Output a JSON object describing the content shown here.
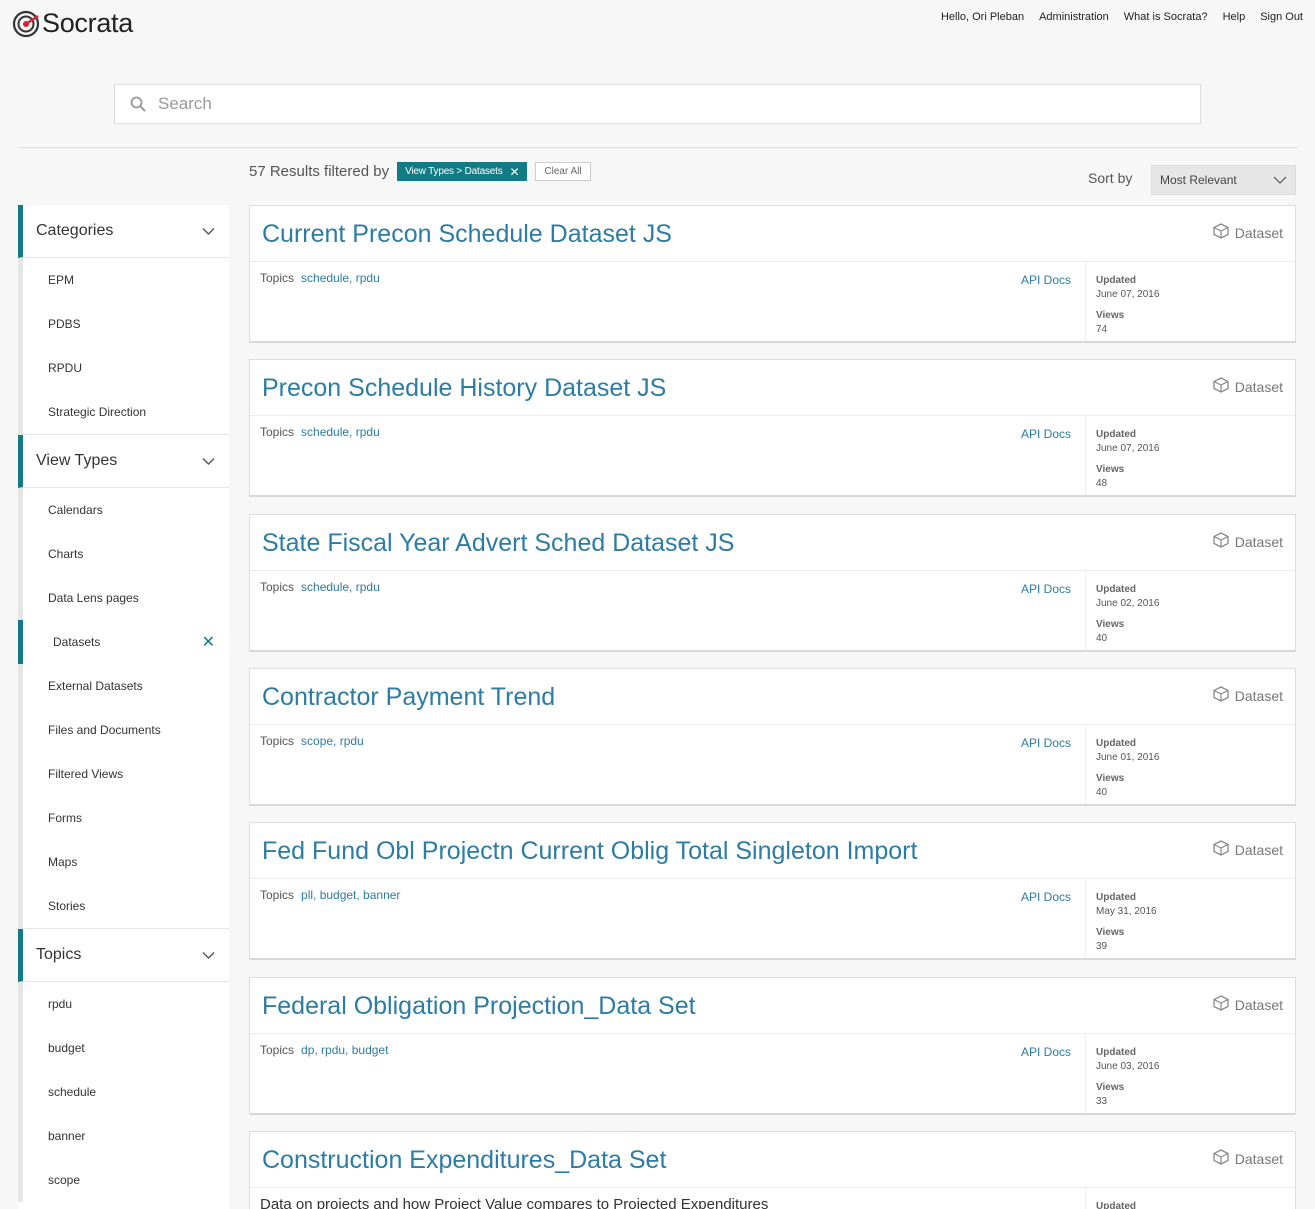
{
  "brand": {
    "name": "Socrata"
  },
  "nav": {
    "hello": "Hello, Ori Pleban",
    "administration": "Administration",
    "what_is": "What is Socrata?",
    "help": "Help",
    "sign_out": "Sign Out"
  },
  "search": {
    "placeholder": "Search"
  },
  "results": {
    "count_text": "57 Results filtered by",
    "filter_pill": "View Types > Datasets",
    "clear_all": "Clear All",
    "sort_label": "Sort by",
    "sort_value": "Most Relevant"
  },
  "sidebar": {
    "categories": {
      "title": "Categories",
      "items": [
        "EPM",
        "PDBS",
        "RPDU",
        "Strategic Direction"
      ]
    },
    "view_types": {
      "title": "View Types",
      "items": [
        "Calendars",
        "Charts",
        "Data Lens pages",
        "Datasets",
        "External Datasets",
        "Files and Documents",
        "Filtered Views",
        "Forms",
        "Maps",
        "Stories"
      ]
    },
    "topics": {
      "title": "Topics",
      "items": [
        "rpdu",
        "budget",
        "schedule",
        "banner",
        "scope"
      ]
    }
  },
  "labels": {
    "topics": "Topics",
    "api_docs": "API Docs",
    "updated": "Updated",
    "views": "Views",
    "dataset": "Dataset"
  },
  "cards": [
    {
      "title": "Current Precon Schedule Dataset JS",
      "topics": "schedule, rpdu",
      "updated": "June 07, 2016",
      "views": "74"
    },
    {
      "title": "Precon Schedule History Dataset JS",
      "topics": "schedule, rpdu",
      "updated": "June 07, 2016",
      "views": "48"
    },
    {
      "title": "State Fiscal Year Advert Sched Dataset JS",
      "topics": "schedule, rpdu",
      "updated": "June 02, 2016",
      "views": "40"
    },
    {
      "title": "Contractor Payment Trend",
      "topics": "scope, rpdu",
      "updated": "June 01, 2016",
      "views": "40"
    },
    {
      "title": "Fed Fund Obl Projectn Current Oblig Total Singleton Import",
      "topics": "pll, budget, banner",
      "updated": "May 31, 2016",
      "views": "39"
    },
    {
      "title": "Federal Obligation Projection_Data Set",
      "topics": "dp, rpdu, budget",
      "updated": "June 03, 2016",
      "views": "33"
    },
    {
      "title": "Construction Expenditures_Data Set",
      "description": "Data on projects and how Project Value compares to Projected Expenditures",
      "updated_label": "Updated"
    }
  ],
  "colors": {
    "accent": "#137b85",
    "link": "#2c7ca3"
  }
}
